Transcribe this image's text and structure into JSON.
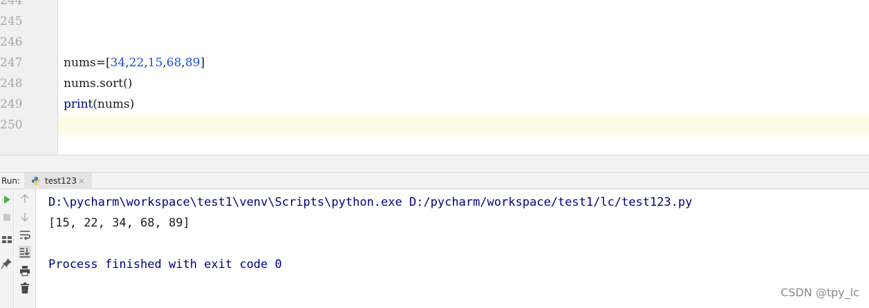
{
  "editor": {
    "lines": [
      {
        "num": "244",
        "code": ""
      },
      {
        "num": "245",
        "code": ""
      },
      {
        "num": "246",
        "code": ""
      },
      {
        "num": "247",
        "code": "nums=[34,22,15,68,89]"
      },
      {
        "num": "248",
        "code": "nums.sort()"
      },
      {
        "num": "249",
        "code": "print(nums)"
      },
      {
        "num": "250",
        "code": ""
      }
    ],
    "current_line": "250",
    "tokens": {
      "l247_a": "nums=[",
      "l247_n1": "34",
      "l247_c1": ",",
      "l247_n2": "22",
      "l247_c2": ",",
      "l247_n3": "15",
      "l247_c3": ",",
      "l247_n4": "68",
      "l247_c4": ",",
      "l247_n5": "89",
      "l247_z": "]",
      "l248": "nums.sort()",
      "l249_kw": "print",
      "l249_rest": "(nums)"
    }
  },
  "run": {
    "label": "Run:",
    "tab": {
      "label": "test123",
      "close": "×",
      "icon": "python-icon"
    },
    "tools": [
      "rerun-icon",
      "stop-icon",
      "layout-icon",
      "pin-icon",
      "up-arrow-icon",
      "down-arrow-icon",
      "soft-wrap-icon",
      "scroll-to-end-icon",
      "print-icon",
      "trash-icon"
    ]
  },
  "console": {
    "command": "D:\\pycharm\\workspace\\test1\\venv\\Scripts\\python.exe D:/pycharm/workspace/test1/lc/test123.py",
    "output": "[15, 22, 34, 68, 89]",
    "blank": "",
    "exit": "Process finished with exit code 0"
  },
  "watermark": "CSDN @tpy_lc",
  "colors": {
    "keyword": "#000080",
    "number": "#1750eb",
    "current_line_bg": "#fefbe8",
    "console_system_text": "#000080",
    "run_green": "#4caf50"
  }
}
